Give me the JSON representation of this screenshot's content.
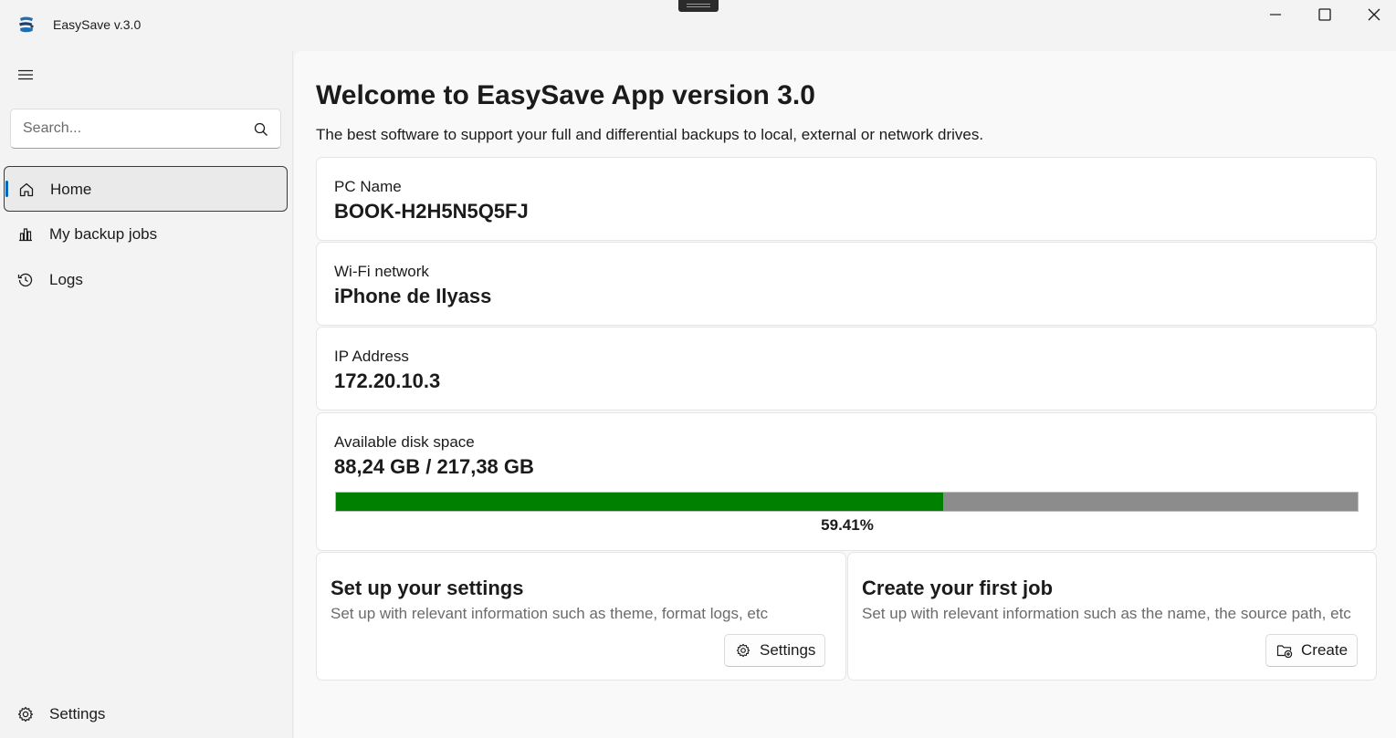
{
  "app": {
    "title": "EasySave v.3.0"
  },
  "colors": {
    "accent": "#0067c0",
    "progress_fill": "#008000",
    "progress_track": "#8c8c8c"
  },
  "sidebar": {
    "search": {
      "placeholder": "Search...",
      "value": ""
    },
    "items": [
      {
        "label": "Home",
        "icon": "home-icon",
        "active": true
      },
      {
        "label": "My backup jobs",
        "icon": "bar-chart-icon",
        "active": false
      },
      {
        "label": "Logs",
        "icon": "history-icon",
        "active": false
      }
    ],
    "footer": {
      "label": "Settings",
      "icon": "gear-icon"
    }
  },
  "main": {
    "title": "Welcome to EasySave App version 3.0",
    "subtitle": "The best software to support your full and differential backups to local, external or network drives.",
    "info": {
      "pc_name": {
        "label": "PC Name",
        "value": "BOOK-H2H5N5Q5FJ"
      },
      "wifi": {
        "label": "Wi-Fi network",
        "value": "iPhone de Ilyass"
      },
      "ip": {
        "label": "IP Address",
        "value": "172.20.10.3"
      },
      "disk": {
        "label": "Available disk space",
        "value": "88,24 GB / 217,38 GB",
        "percent_text": "59.41%",
        "fraction": 0.5941
      }
    },
    "actions": {
      "settings": {
        "title": "Set up your settings",
        "description": "Set up with relevant information such as theme, format logs, etc",
        "button_label": "Settings",
        "button_icon": "gear-icon"
      },
      "create": {
        "title": "Create your first job",
        "description": "Set up with relevant information such as the name, the source path, etc",
        "button_label": "Create",
        "button_icon": "folder-add-icon"
      }
    }
  }
}
